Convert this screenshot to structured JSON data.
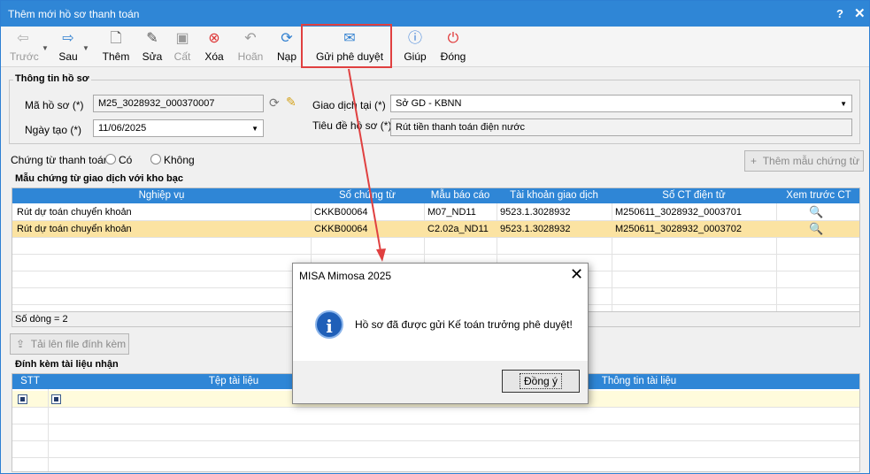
{
  "window": {
    "title": "Thêm mới hồ sơ thanh toán",
    "help": "?",
    "close": "✕"
  },
  "toolbar": {
    "prev": "Trước",
    "next": "Sau",
    "add": "Thêm",
    "edit": "Sửa",
    "save": "Cất",
    "delete": "Xóa",
    "undo": "Hoãn",
    "reload": "Nạp",
    "submit": "Gửi phê duyệt",
    "help": "Giúp",
    "close": "Đóng"
  },
  "info": {
    "section_title": "Thông tin hồ sơ",
    "code_label": "Mã hồ sơ (*)",
    "code_value": "M25_3028932_000370007",
    "date_label": "Ngày tạo (*)",
    "date_value": "11/06/2025",
    "txn_label": "Giao dịch tại (*)",
    "txn_value": "Sở GD - KBNN",
    "subject_label": "Tiêu đề hồ sơ (*)",
    "subject_value": "Rút tiền thanh toán điện nước"
  },
  "payment": {
    "label": "Chứng từ thanh toán:",
    "yes": "Có",
    "no": "Không",
    "add_template": "Thêm mẫu chứng từ"
  },
  "vouchers": {
    "section_title": "Mẫu chứng từ giao dịch với kho bạc",
    "headers": [
      "Nghiệp vụ",
      "Số chứng từ",
      "Mẫu báo cáo",
      "Tài khoản giao dịch",
      "Số CT điện tử",
      "Xem trước CT"
    ],
    "rows": [
      [
        "Rút dự toán chuyển khoản",
        "CKKB00064",
        "M07_ND11",
        "9523.1.3028932",
        "M250611_3028932_0003701"
      ],
      [
        "Rút dự toán chuyển khoản",
        "CKKB00064",
        "C2.02a_ND11",
        "9523.1.3028932",
        "M250611_3028932_0003702"
      ]
    ],
    "footer": "Số dòng = 2"
  },
  "upload": {
    "label": "Tải lên file đính kèm"
  },
  "attachments": {
    "section_title": "Đính kèm tài liệu nhận",
    "headers": [
      "STT",
      "Tệp tài liệu",
      "Thông tin tài liệu"
    ]
  },
  "dialog": {
    "title": "MISA Mimosa 2025",
    "close": "✕",
    "message": "Hồ sơ đã được gửi Kế toán trưởng phê duyệt!",
    "ok": "Đồng ý"
  },
  "colors": {
    "accent": "#2f86d6",
    "highlight_row": "#fbe3a2",
    "annotation": "#e04040"
  }
}
